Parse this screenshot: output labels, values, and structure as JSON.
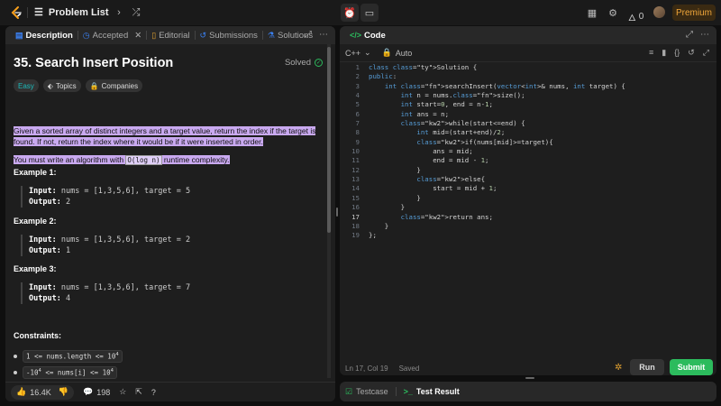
{
  "topbar": {
    "list_title": "Problem List",
    "streak": "0",
    "premium": "Premium"
  },
  "left_tabs": [
    {
      "label": "Description",
      "icon": "doc-icon"
    },
    {
      "label": "Accepted",
      "icon": "clock-icon"
    },
    {
      "label": "Editorial",
      "icon": "book-icon"
    },
    {
      "label": "Submissions",
      "icon": "history-icon"
    },
    {
      "label": "Solutions",
      "icon": "flask-icon"
    }
  ],
  "problem": {
    "title": "35. Search Insert Position",
    "status": "Solved",
    "difficulty": "Easy",
    "topics": "Topics",
    "companies": "Companies",
    "desc_p1": "Given a sorted array of distinct integers and a target value, return the index if the target is found. If not, return the index where it would be if it were inserted in order.",
    "desc_p2a": "You must write an algorithm with ",
    "desc_p2_code": "O(log n)",
    "desc_p2b": " runtime complexity."
  },
  "examples": [
    {
      "title": "Example 1:",
      "input_label": "Input:",
      "input": "nums = [1,3,5,6], target = 5",
      "output_label": "Output:",
      "output": "2"
    },
    {
      "title": "Example 2:",
      "input_label": "Input:",
      "input": "nums = [1,3,5,6], target = 2",
      "output_label": "Output:",
      "output": "1"
    },
    {
      "title": "Example 3:",
      "input_label": "Input:",
      "input": "nums = [1,3,5,6], target = 7",
      "output_label": "Output:",
      "output": "4"
    }
  ],
  "constraints": {
    "title": "Constraints:",
    "c1": "1 <= nums.length <= 10",
    "c1_sup": "4",
    "c2_pre": "-10",
    "c2_sup1": "4",
    "c2_mid": " <= nums[i] <= 10",
    "c2_sup2": "4"
  },
  "footer": {
    "likes": "16.4K",
    "comments": "198"
  },
  "code_panel": {
    "title": "Code",
    "language": "C++",
    "mode": "Auto",
    "cursor": "Ln 17, Col 19",
    "saved": "Saved",
    "run": "Run",
    "submit": "Submit"
  },
  "code_lines": [
    "class Solution {",
    "public:",
    "    int searchInsert(vector<int>& nums, int target) {",
    "        int n = nums.size();",
    "        int start=0, end = n-1;",
    "        int ans = n;",
    "        while(start<=end) {",
    "            int mid=(start+end)/2;",
    "            if(nums[mid]>=target){",
    "                ans = mid;",
    "                end = mid - 1;",
    "            }",
    "            else{",
    "                start = mid + 1;",
    "            }",
    "        }",
    "        return ans;",
    "    }",
    "};"
  ],
  "bottom_tabs": {
    "testcase": "Testcase",
    "result": "Test Result"
  }
}
